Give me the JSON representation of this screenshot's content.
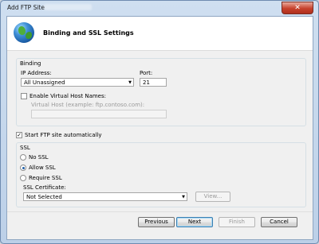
{
  "window": {
    "title": "Add FTP Site",
    "close_glyph": "✕"
  },
  "header": {
    "title": "Binding and SSL Settings",
    "icon": "globe-icon"
  },
  "binding": {
    "group_label": "Binding",
    "ip_label": "IP Address:",
    "ip_value": "All Unassigned",
    "port_label": "Port:",
    "port_value": "21",
    "enable_virtual_host_label": "Enable Virtual Host Names:",
    "enable_virtual_host_checked": false,
    "virtual_host_label": "Virtual Host (example: ftp.contoso.com):",
    "virtual_host_value": ""
  },
  "start_automatically": {
    "label": "Start FTP site automatically",
    "checked": true,
    "check_glyph": "✓"
  },
  "ssl": {
    "group_label": "SSL",
    "options": [
      "No SSL",
      "Allow SSL",
      "Require SSL"
    ],
    "selected": "Allow SSL",
    "certificate_label": "SSL Certificate:",
    "certificate_value": "Not Selected",
    "view_button": "View..."
  },
  "buttons": {
    "previous": "Previous",
    "next": "Next",
    "finish": "Finish",
    "cancel": "Cancel"
  }
}
